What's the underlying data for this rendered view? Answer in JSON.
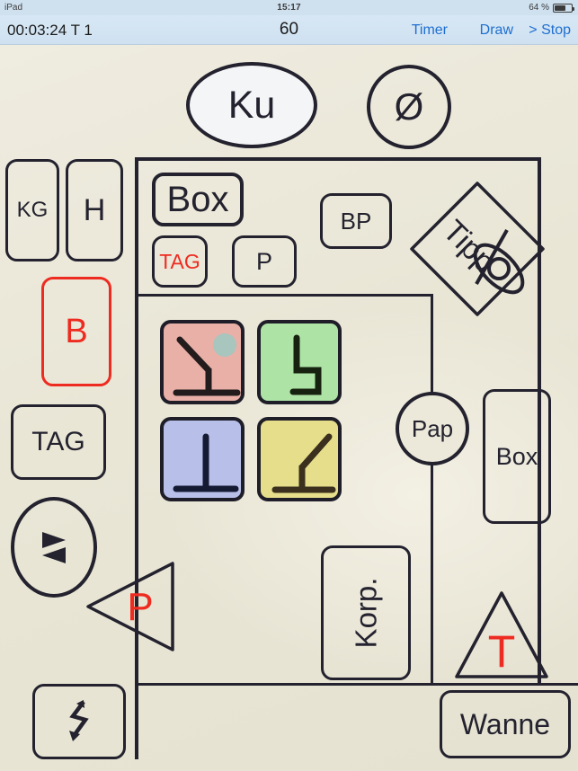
{
  "statusbar": {
    "device": "iPad",
    "time": "15:17",
    "battery_percent": "64 %",
    "battery_level": 64
  },
  "toolbar": {
    "timecode": "00:03:24  T 1",
    "score": "60",
    "timer_label": "Timer",
    "draw_label": "Draw",
    "stop_label": "> Stop",
    "accent_color": "#1f6fd0"
  },
  "board": {
    "background_color": "#ece9da",
    "ink_color": "#23222e",
    "highlight_color": "#ee2b20",
    "shapes": {
      "ku": {
        "label": "Ku",
        "shape": "ellipse",
        "filled": true
      },
      "phi": {
        "label": "Ø",
        "shape": "circle",
        "filled": false
      },
      "kg": {
        "label": "KG",
        "shape": "rounded-rect"
      },
      "h": {
        "label": "H",
        "shape": "rounded-rect"
      },
      "b": {
        "label": "B",
        "shape": "rounded-rect",
        "color": "#ee2b20"
      },
      "tag_left": {
        "label": "TAG",
        "shape": "rounded-rect"
      },
      "box_big": {
        "label": "Box",
        "shape": "rounded-rect"
      },
      "tag_red": {
        "label": "TAG",
        "shape": "rounded-rect",
        "color": "#ee2b20"
      },
      "p_small": {
        "label": "P",
        "shape": "rounded-rect"
      },
      "bp": {
        "label": "BP",
        "shape": "rounded-rect"
      },
      "tipp": {
        "label": "Tipp",
        "shape": "diamond",
        "symbol": "slashed-ellipse"
      },
      "pap": {
        "label": "Pap",
        "shape": "circle"
      },
      "box_right": {
        "label": "Box",
        "shape": "rounded-rect"
      },
      "korp": {
        "label": "Korp.",
        "shape": "rounded-rect",
        "rotated": true
      },
      "p_triangle": {
        "label": "P",
        "shape": "triangle-left",
        "color": "#ee2b20"
      },
      "t_triangle": {
        "label": "T",
        "shape": "triangle-up",
        "color": "#ee2b20"
      },
      "wanne": {
        "label": "Wanne",
        "shape": "rounded-rect"
      },
      "swap": {
        "shape": "ellipse",
        "icon": "double-triangle-icon"
      },
      "bolt": {
        "shape": "rounded-rect",
        "icon": "lightning-bolt-icon"
      }
    },
    "tiles": [
      {
        "name": "tile-pink",
        "color": "#e9b0a7",
        "glyph": "diagonal-down-left-stand",
        "marker": true,
        "marker_color": "#a8c5be"
      },
      {
        "name": "tile-green",
        "color": "#aee3a6",
        "glyph": "step-down-right",
        "marker": false
      },
      {
        "name": "tile-blue",
        "color": "#b8c0ea",
        "glyph": "upright-tee",
        "marker": false
      },
      {
        "name": "tile-yellow",
        "color": "#e6de8b",
        "glyph": "diagonal-up-right-stand",
        "marker": false
      }
    ]
  }
}
